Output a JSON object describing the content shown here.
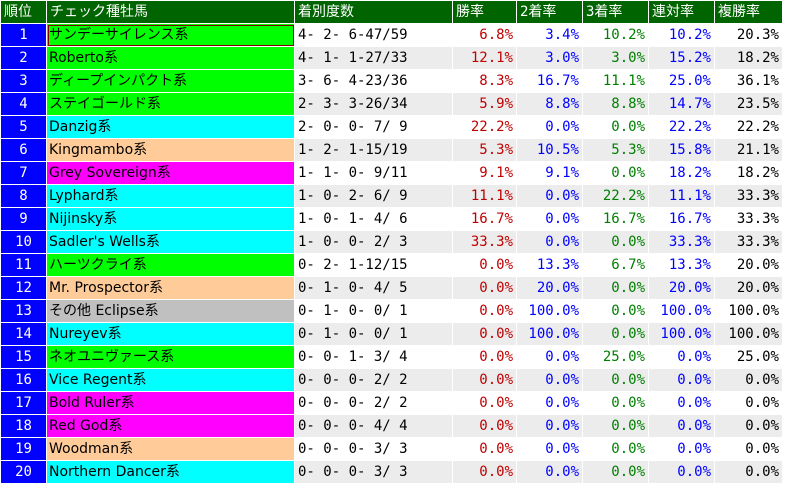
{
  "columns": {
    "rank": "順位",
    "sire": "チェック種牡馬",
    "record": "着別度数",
    "win": "勝率",
    "second": "2着率",
    "third": "3着率",
    "rentai": "連対率",
    "fukusho": "複勝率"
  },
  "colors": {
    "header_bg": "#006400",
    "rank_bg": "#0000ff",
    "win_text": "#c00000",
    "second_text": "#0000ff",
    "third_text": "#008000",
    "rentai_text": "#0000ff",
    "green": "#00ff00",
    "cyan": "#00ffff",
    "orange": "#ffcc99",
    "magenta": "#ff00ff",
    "gray": "#c0c0c0"
  },
  "rows": [
    {
      "rank": "1",
      "sire": "サンデーサイレンス系",
      "cat": "green",
      "record": "4- 2- 6-47/59",
      "win": "6.8%",
      "second": "3.4%",
      "third": "10.2%",
      "rentai": "10.2%",
      "fukusho": "20.3%"
    },
    {
      "rank": "2",
      "sire": "Roberto系",
      "cat": "green",
      "record": "4- 1- 1-27/33",
      "win": "12.1%",
      "second": "3.0%",
      "third": "3.0%",
      "rentai": "15.2%",
      "fukusho": "18.2%"
    },
    {
      "rank": "3",
      "sire": "ディープインパクト系",
      "cat": "green",
      "record": "3- 6- 4-23/36",
      "win": "8.3%",
      "second": "16.7%",
      "third": "11.1%",
      "rentai": "25.0%",
      "fukusho": "36.1%"
    },
    {
      "rank": "4",
      "sire": "ステイゴールド系",
      "cat": "green",
      "record": "2- 3- 3-26/34",
      "win": "5.9%",
      "second": "8.8%",
      "third": "8.8%",
      "rentai": "14.7%",
      "fukusho": "23.5%"
    },
    {
      "rank": "5",
      "sire": "Danzig系",
      "cat": "cyan",
      "record": "2- 0- 0- 7/ 9",
      "win": "22.2%",
      "second": "0.0%",
      "third": "0.0%",
      "rentai": "22.2%",
      "fukusho": "22.2%"
    },
    {
      "rank": "6",
      "sire": "Kingmambo系",
      "cat": "orange",
      "record": "1- 2- 1-15/19",
      "win": "5.3%",
      "second": "10.5%",
      "third": "5.3%",
      "rentai": "15.8%",
      "fukusho": "21.1%"
    },
    {
      "rank": "7",
      "sire": "Grey Sovereign系",
      "cat": "magenta",
      "record": "1- 1- 0- 9/11",
      "win": "9.1%",
      "second": "9.1%",
      "third": "0.0%",
      "rentai": "18.2%",
      "fukusho": "18.2%"
    },
    {
      "rank": "8",
      "sire": "Lyphard系",
      "cat": "cyan",
      "record": "1- 0- 2- 6/ 9",
      "win": "11.1%",
      "second": "0.0%",
      "third": "22.2%",
      "rentai": "11.1%",
      "fukusho": "33.3%"
    },
    {
      "rank": "9",
      "sire": "Nijinsky系",
      "cat": "cyan",
      "record": "1- 0- 1- 4/ 6",
      "win": "16.7%",
      "second": "0.0%",
      "third": "16.7%",
      "rentai": "16.7%",
      "fukusho": "33.3%"
    },
    {
      "rank": "10",
      "sire": "Sadler's Wells系",
      "cat": "cyan",
      "record": "1- 0- 0- 2/ 3",
      "win": "33.3%",
      "second": "0.0%",
      "third": "0.0%",
      "rentai": "33.3%",
      "fukusho": "33.3%"
    },
    {
      "rank": "11",
      "sire": "ハーツクライ系",
      "cat": "green",
      "record": "0- 2- 1-12/15",
      "win": "0.0%",
      "second": "13.3%",
      "third": "6.7%",
      "rentai": "13.3%",
      "fukusho": "20.0%"
    },
    {
      "rank": "12",
      "sire": "Mr. Prospector系",
      "cat": "orange",
      "record": "0- 1- 0- 4/ 5",
      "win": "0.0%",
      "second": "20.0%",
      "third": "0.0%",
      "rentai": "20.0%",
      "fukusho": "20.0%"
    },
    {
      "rank": "13",
      "sire": "その他 Eclipse系",
      "cat": "gray",
      "record": "0- 1- 0- 0/ 1",
      "win": "0.0%",
      "second": "100.0%",
      "third": "0.0%",
      "rentai": "100.0%",
      "fukusho": "100.0%"
    },
    {
      "rank": "14",
      "sire": "Nureyev系",
      "cat": "cyan",
      "record": "0- 1- 0- 0/ 1",
      "win": "0.0%",
      "second": "100.0%",
      "third": "0.0%",
      "rentai": "100.0%",
      "fukusho": "100.0%"
    },
    {
      "rank": "15",
      "sire": "ネオユニヴァース系",
      "cat": "green",
      "record": "0- 0- 1- 3/ 4",
      "win": "0.0%",
      "second": "0.0%",
      "third": "25.0%",
      "rentai": "0.0%",
      "fukusho": "25.0%"
    },
    {
      "rank": "16",
      "sire": "Vice Regent系",
      "cat": "cyan",
      "record": "0- 0- 0- 2/ 2",
      "win": "0.0%",
      "second": "0.0%",
      "third": "0.0%",
      "rentai": "0.0%",
      "fukusho": "0.0%"
    },
    {
      "rank": "17",
      "sire": "Bold Ruler系",
      "cat": "magenta",
      "record": "0- 0- 0- 2/ 2",
      "win": "0.0%",
      "second": "0.0%",
      "third": "0.0%",
      "rentai": "0.0%",
      "fukusho": "0.0%"
    },
    {
      "rank": "18",
      "sire": "Red God系",
      "cat": "magenta",
      "record": "0- 0- 0- 4/ 4",
      "win": "0.0%",
      "second": "0.0%",
      "third": "0.0%",
      "rentai": "0.0%",
      "fukusho": "0.0%"
    },
    {
      "rank": "19",
      "sire": "Woodman系",
      "cat": "orange",
      "record": "0- 0- 0- 3/ 3",
      "win": "0.0%",
      "second": "0.0%",
      "third": "0.0%",
      "rentai": "0.0%",
      "fukusho": "0.0%"
    },
    {
      "rank": "20",
      "sire": "Northern Dancer系",
      "cat": "cyan",
      "record": "0- 0- 0- 3/ 3",
      "win": "0.0%",
      "second": "0.0%",
      "third": "0.0%",
      "rentai": "0.0%",
      "fukusho": "0.0%"
    }
  ]
}
